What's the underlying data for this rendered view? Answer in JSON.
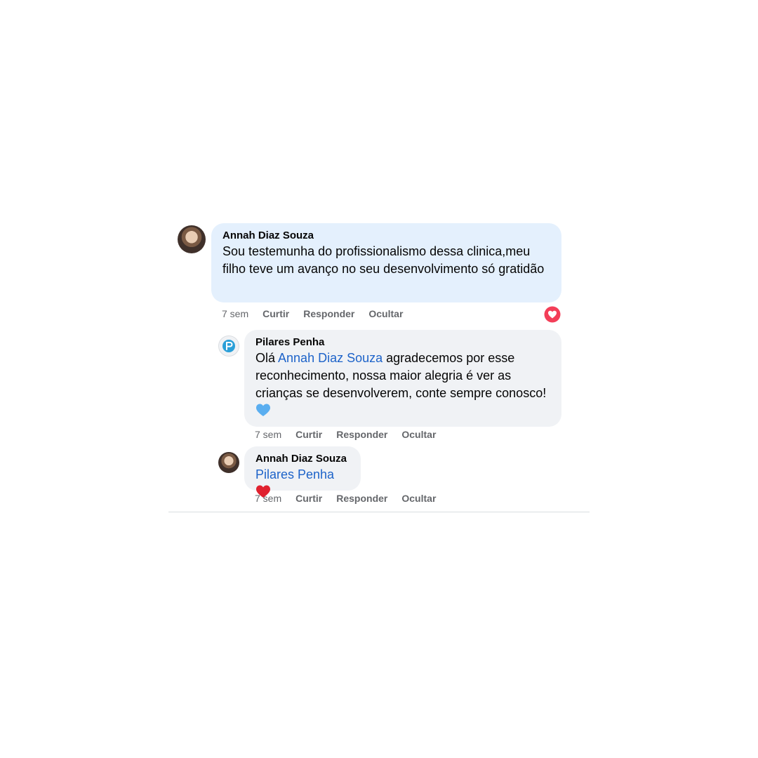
{
  "comments": [
    {
      "author": "Annah Diaz Souza",
      "text": "Sou testemunha do profissionalismo dessa clinica,meu filho teve um avanço no seu desenvolvimento só gratidão",
      "time": "7 sem",
      "actions": [
        "Curtir",
        "Responder",
        "Ocultar"
      ],
      "reaction_icon": "heart-reaction-icon"
    },
    {
      "author": "Pilares Penha",
      "mention": "Annah Diaz Souza",
      "text_after_mention": " agradecemos por esse reconhecimento, nossa maior alegria é ver as crianças se desenvolverem, conte sempre conosco!",
      "emoji": "blue-heart-icon",
      "time": "7 sem",
      "actions": [
        "Curtir",
        "Responder",
        "Ocultar"
      ]
    },
    {
      "author": "Annah Diaz Souza",
      "mention": "Pilares Penha",
      "emoji": "red-heart-icon",
      "time": "7 sem",
      "actions": [
        "Curtir",
        "Responder",
        "Ocultar"
      ]
    }
  ],
  "colors": {
    "bubble_blue": "#e4f0fd",
    "bubble_gray": "#f0f2f5",
    "mention": "#1d63c9",
    "meta": "#65676b",
    "reaction_heart": "#f33e58"
  }
}
